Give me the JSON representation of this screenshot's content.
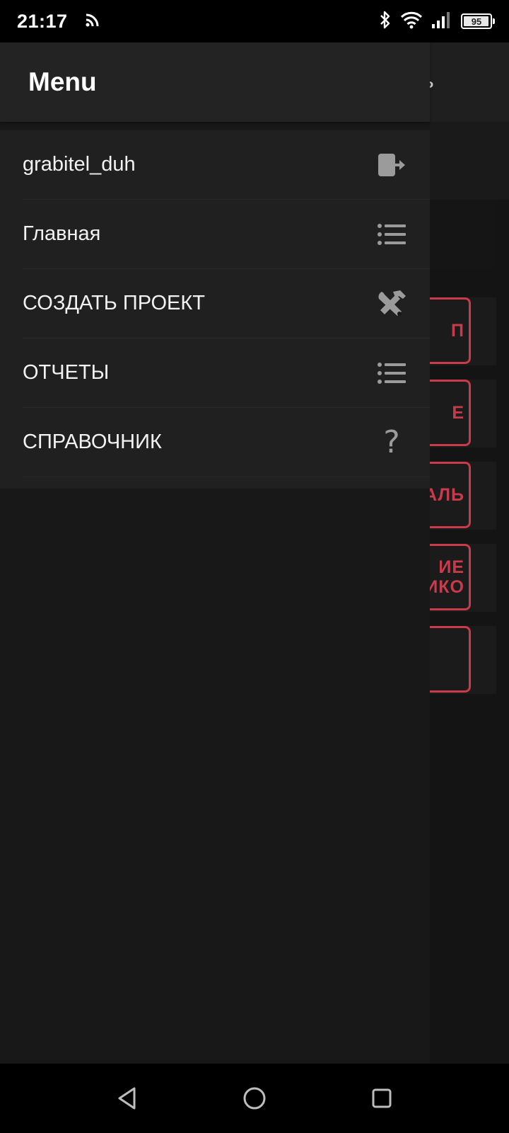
{
  "status_bar": {
    "time": "21:17",
    "battery_level": "95",
    "icons": [
      "cast-icon",
      "bluetooth-icon",
      "wifi-icon",
      "signal-icon",
      "battery-icon"
    ]
  },
  "drawer": {
    "title": "Menu",
    "items": [
      {
        "label": "grabitel_duh",
        "icon": "logout-icon"
      },
      {
        "label": "Главная",
        "icon": "list-icon"
      },
      {
        "label": "СОЗДАТЬ ПРОЕКТ",
        "icon": "tools-icon"
      },
      {
        "label": "ОТЧЕТЫ",
        "icon": "list-icon"
      },
      {
        "label": "СПРАВОЧНИК",
        "icon": "help-icon",
        "glyph": "?"
      }
    ]
  },
  "background": {
    "toolbar_glyph": "ь",
    "buttons": [
      "П",
      "Е",
      "АЛЬ",
      "ИЕ\nИКО",
      ""
    ]
  },
  "colors": {
    "accent_red": "#c93a4b",
    "drawer_bg": "#202020",
    "header_bg": "#232323",
    "icon_gray": "#9b9b9b"
  }
}
